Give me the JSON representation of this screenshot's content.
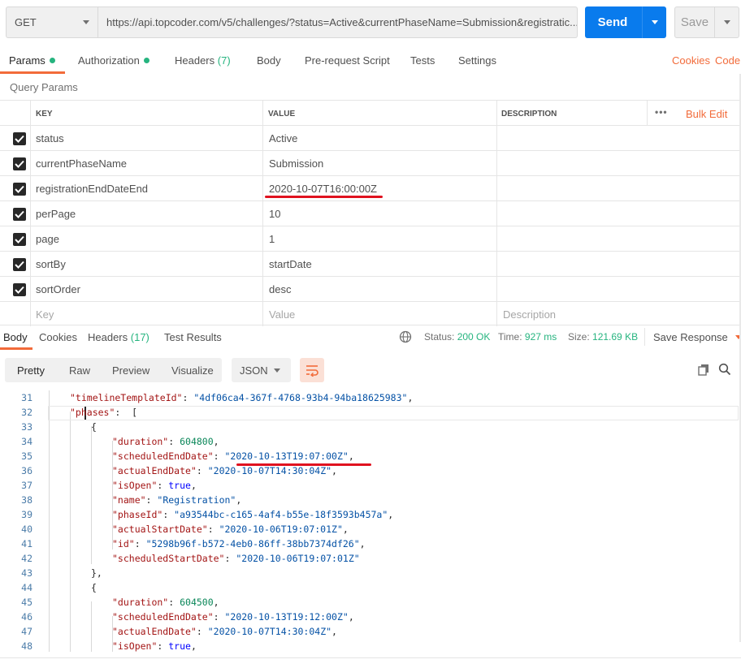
{
  "request": {
    "method": "GET",
    "url": "https://api.topcoder.com/v5/challenges/?status=Active&currentPhaseName=Submission&registratic...",
    "send_label": "Send",
    "save_label": "Save"
  },
  "request_tabs": [
    {
      "label": "Params",
      "dot": true,
      "active": true
    },
    {
      "label": "Authorization",
      "dot": true
    },
    {
      "label": "Headers",
      "count": "(7)"
    },
    {
      "label": "Body"
    },
    {
      "label": "Pre-request Script"
    },
    {
      "label": "Tests"
    },
    {
      "label": "Settings"
    }
  ],
  "links": {
    "cookies": "Cookies",
    "code": "Code"
  },
  "query_params_title": "Query Params",
  "table": {
    "headers": {
      "key": "KEY",
      "value": "VALUE",
      "description": "DESCRIPTION"
    },
    "more": "•••",
    "bulk_edit": "Bulk Edit",
    "rows": [
      {
        "key": "status",
        "value": "Active"
      },
      {
        "key": "currentPhaseName",
        "value": "Submission"
      },
      {
        "key": "registrationEndDateEnd",
        "value": "2020-10-07T16:00:00Z"
      },
      {
        "key": "perPage",
        "value": "10"
      },
      {
        "key": "page",
        "value": "1"
      },
      {
        "key": "sortBy",
        "value": "startDate"
      },
      {
        "key": "sortOrder",
        "value": "desc"
      }
    ],
    "placeholders": {
      "key": "Key",
      "value": "Value",
      "description": "Description"
    }
  },
  "response_tabs": [
    {
      "label": "Body",
      "active": true
    },
    {
      "label": "Cookies"
    },
    {
      "label": "Headers",
      "count": "(17)"
    },
    {
      "label": "Test Results"
    }
  ],
  "status": {
    "status_label": "Status:",
    "status_value": "200 OK",
    "time_label": "Time:",
    "time_value": "927 ms",
    "size_label": "Size:",
    "size_value": "121.69 KB",
    "save_response": "Save Response"
  },
  "view_modes": [
    "Pretty",
    "Raw",
    "Preview",
    "Visualize"
  ],
  "format": "JSON",
  "code_lines": [
    {
      "n": "31",
      "indent": 1,
      "key": "timelineTemplateId",
      "val": "\"4df06ca4-367f-4768-93b4-94ba18625983\"",
      "vt": "s",
      "tail": ","
    },
    {
      "n": "32",
      "indent": 1,
      "key": "phases",
      "raw": " ["
    },
    {
      "n": "33",
      "indent": 2,
      "raw": "{"
    },
    {
      "n": "34",
      "indent": 3,
      "key": "duration",
      "val": "604800",
      "vt": "n",
      "tail": ","
    },
    {
      "n": "35",
      "indent": 3,
      "key": "scheduledEndDate",
      "val": "\"2020-10-13T19:07:00Z\"",
      "vt": "s",
      "tail": ","
    },
    {
      "n": "36",
      "indent": 3,
      "key": "actualEndDate",
      "val": "\"2020-10-07T14:30:04Z\"",
      "vt": "s",
      "tail": ","
    },
    {
      "n": "37",
      "indent": 3,
      "key": "isOpen",
      "val": "true",
      "vt": "b",
      "tail": ","
    },
    {
      "n": "38",
      "indent": 3,
      "key": "name",
      "val": "\"Registration\"",
      "vt": "s",
      "tail": ","
    },
    {
      "n": "39",
      "indent": 3,
      "key": "phaseId",
      "val": "\"a93544bc-c165-4af4-b55e-18f3593b457a\"",
      "vt": "s",
      "tail": ","
    },
    {
      "n": "40",
      "indent": 3,
      "key": "actualStartDate",
      "val": "\"2020-10-06T19:07:01Z\"",
      "vt": "s",
      "tail": ","
    },
    {
      "n": "41",
      "indent": 3,
      "key": "id",
      "val": "\"5298b96f-b572-4eb0-86ff-38bb7374df26\"",
      "vt": "s",
      "tail": ","
    },
    {
      "n": "42",
      "indent": 3,
      "key": "scheduledStartDate",
      "val": "\"2020-10-06T19:07:01Z\"",
      "vt": "s"
    },
    {
      "n": "43",
      "indent": 2,
      "raw": "},"
    },
    {
      "n": "44",
      "indent": 2,
      "raw": "{"
    },
    {
      "n": "45",
      "indent": 3,
      "key": "duration",
      "val": "604500",
      "vt": "n",
      "tail": ","
    },
    {
      "n": "46",
      "indent": 3,
      "key": "scheduledEndDate",
      "val": "\"2020-10-13T19:12:00Z\"",
      "vt": "s",
      "tail": ","
    },
    {
      "n": "47",
      "indent": 3,
      "key": "actualEndDate",
      "val": "\"2020-10-07T14:30:04Z\"",
      "vt": "s",
      "tail": ","
    },
    {
      "n": "48",
      "indent": 3,
      "key": "isOpen",
      "val": "true",
      "vt": "b",
      "tail": ","
    }
  ]
}
